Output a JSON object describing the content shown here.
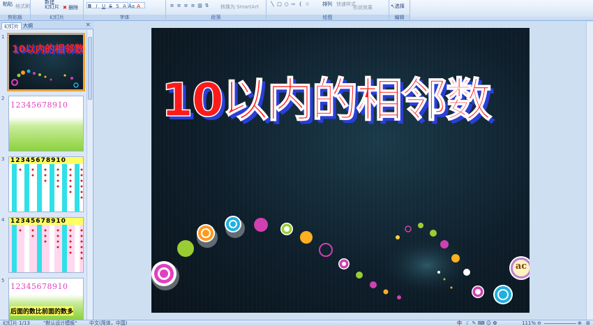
{
  "ribbon": {
    "clipboard": {
      "paste": "粘贴",
      "format_painter": "格式刷",
      "label": "剪贴板"
    },
    "slides": {
      "new_slide": "新建\n幻灯片",
      "delete": "删除",
      "label": "幻灯片"
    },
    "font": {
      "label": "字体"
    },
    "paragraph": {
      "convert_smartart": "转换为 SmartArt",
      "label": "段落"
    },
    "drawing": {
      "arrange": "排列",
      "quick_styles": "快速样式",
      "shape_effects": "形状效果",
      "label": "绘图"
    },
    "editing": {
      "select": "选择",
      "label": "编辑"
    }
  },
  "pane": {
    "tab_slides": "幻灯片",
    "tab_outline": "大纲",
    "close": "×",
    "thumbs": [
      {
        "num": "1"
      },
      {
        "num": "2",
        "digits": "12345678910"
      },
      {
        "num": "3",
        "digits": "12345678910"
      },
      {
        "num": "4",
        "digits": "12345678910"
      },
      {
        "num": "5",
        "digits": "12345678910",
        "caption": "后面的数比前面的数多"
      }
    ]
  },
  "slide": {
    "title": "10以内的相邻数",
    "logo": "ac"
  },
  "status": {
    "slide_pos": "幻灯片 1/13",
    "theme": "\"默认设计模板\"",
    "language": "中文(简体，中国)",
    "ime": "中",
    "zoom": "111%"
  },
  "colors": {
    "title_fill": "#ff1a1a",
    "title_shadow": "#2a3fd6",
    "slide_bg": "#0e1e2a",
    "thumb2_bg": "#8cd23e",
    "digit_magenta": "#e040c0"
  }
}
